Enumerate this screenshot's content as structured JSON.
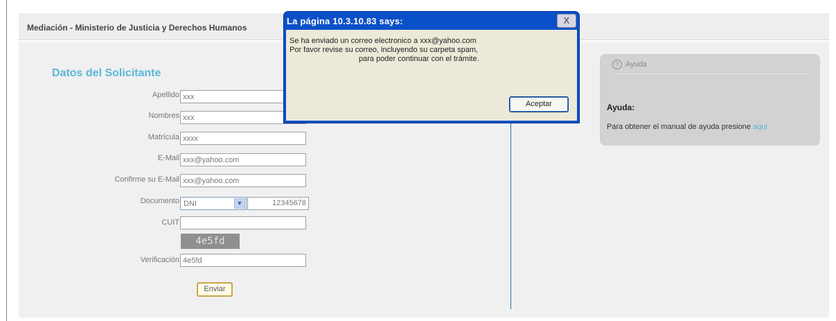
{
  "header": {
    "title": "Mediación - Ministerio de Justicia y Derechos Humanos"
  },
  "form": {
    "title": "Datos del Solicitante",
    "apellido": {
      "label": "Apellido",
      "value": "xxx"
    },
    "nombres": {
      "label": "Nombres",
      "value": "xxx"
    },
    "matricula": {
      "label": "Matrícula",
      "value": "xxxx"
    },
    "email": {
      "label": "E-Mail",
      "value": "xxx@yahoo.com"
    },
    "email_confirm": {
      "label": "Confirme su E-Mail",
      "value": "xxx@yahoo.com"
    },
    "documento": {
      "label": "Documento",
      "type": "DNI",
      "number": "12345678"
    },
    "cuit": {
      "label": "CUIT",
      "value": ""
    },
    "captcha": "4e5fd",
    "verificacion": {
      "label": "Verificación",
      "value": "4e5fd"
    },
    "submit_label": "Enviar"
  },
  "help": {
    "header": "Ayuda",
    "title": "Ayuda:",
    "text": "Para obtener el manual de ayuda presione",
    "link": "aqui"
  },
  "dialog": {
    "title": "La página 10.3.10.83 says:",
    "close": "X",
    "line1": "Se ha enviado un correo electronico a xxx@yahoo.com",
    "line2": "Por favor revise su correo, incluyendo su carpeta spam,",
    "line3": "para poder continuar con el trámite.",
    "ok_label": "Aceptar"
  },
  "colors": {
    "section_title": "#5bb7d6",
    "dialog_titlebar": "#0a50c8",
    "dialog_body": "#ece9d8",
    "divider": "#2f6f9c"
  }
}
